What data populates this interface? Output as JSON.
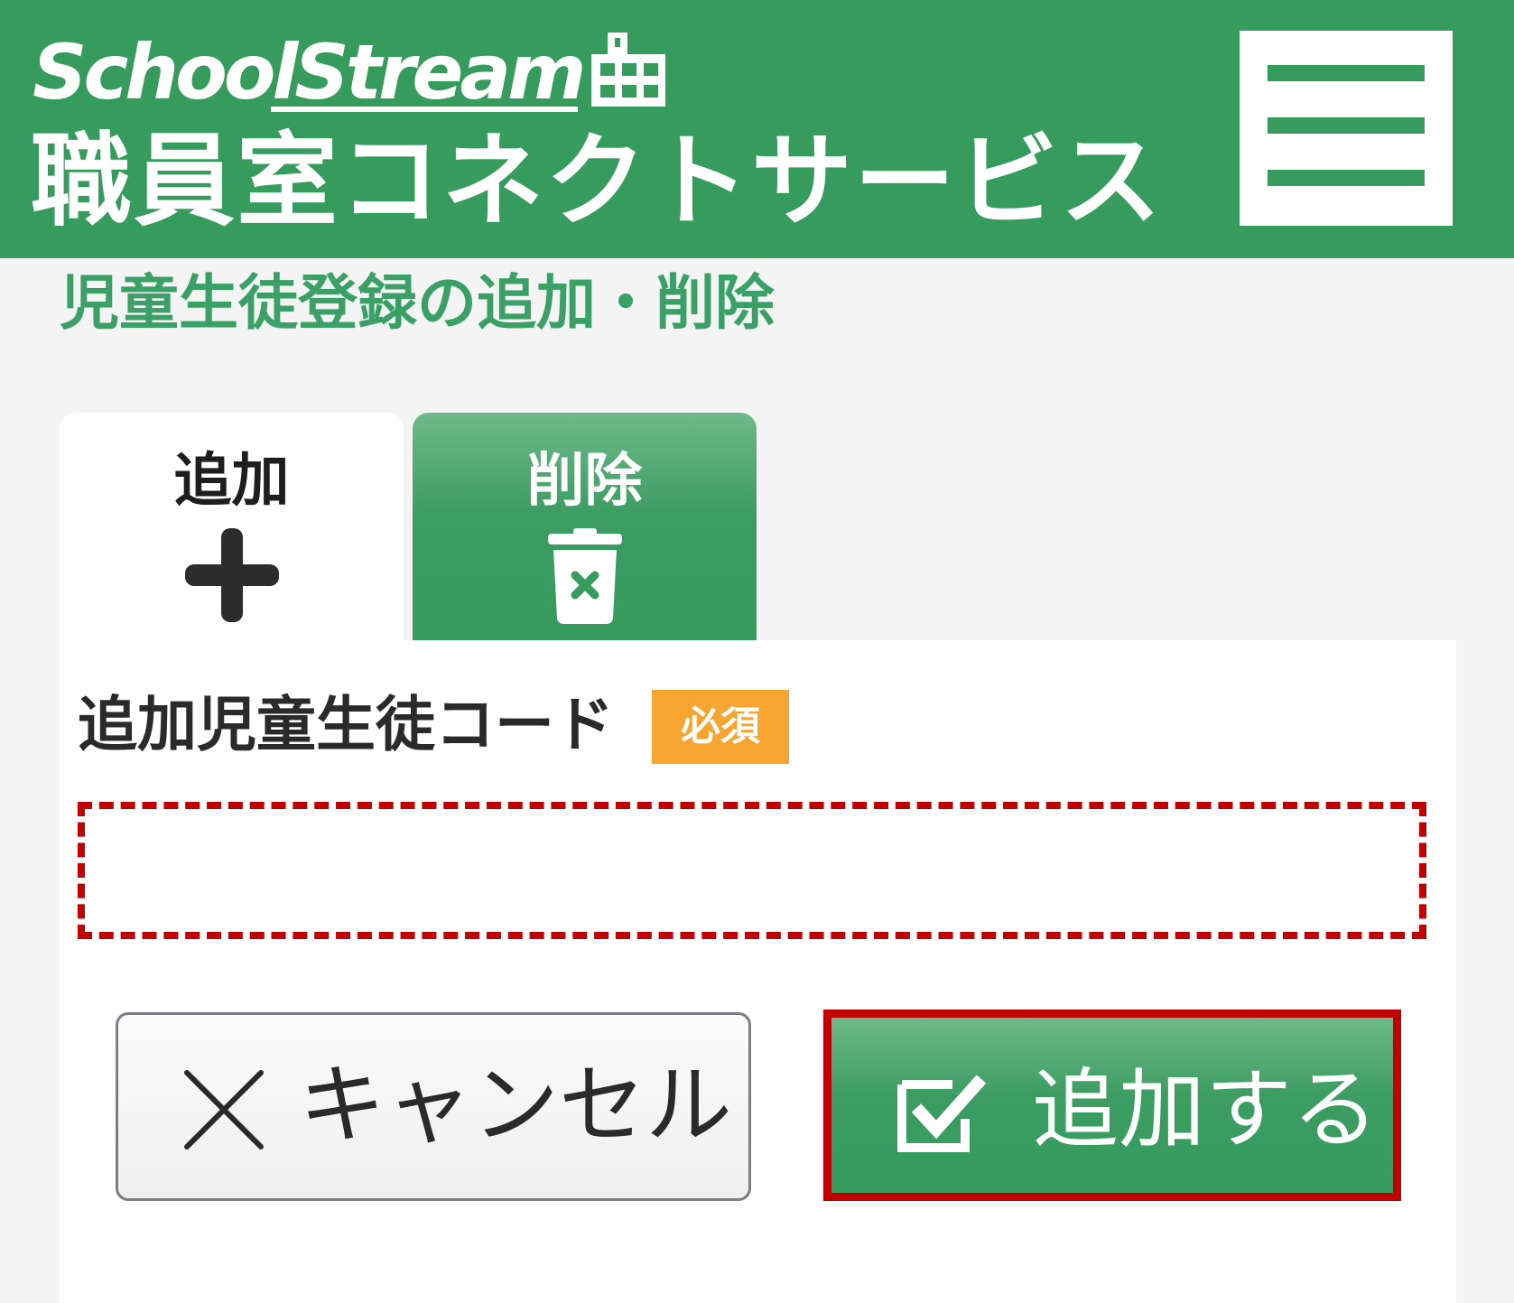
{
  "header": {
    "brand": "SchoolStream",
    "service_name": "職員室コネクトサービス",
    "brand_color": "#359c5e",
    "icons": [
      "building-icon",
      "hamburger-menu-icon"
    ]
  },
  "page": {
    "title": "児童生徒登録の追加・削除"
  },
  "tabs": [
    {
      "label": "追加",
      "icon": "plus-icon",
      "active": true
    },
    {
      "label": "削除",
      "icon": "trash-icon",
      "active": false
    }
  ],
  "form": {
    "field_label": "追加児童生徒コード",
    "required_badge": "必須",
    "code_value": "",
    "required_color": "#f6a531",
    "highlight_color": "#c00000"
  },
  "actions": {
    "cancel_label": "キャンセル",
    "cancel_icon": "close-icon",
    "submit_label": "追加する",
    "submit_icon": "checkbox-check-icon"
  }
}
